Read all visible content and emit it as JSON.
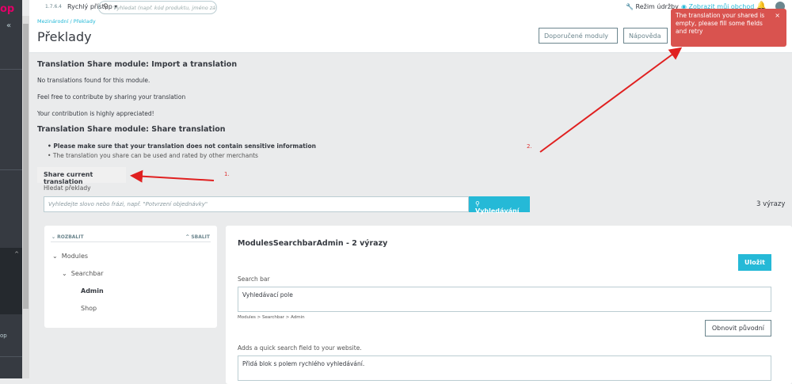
{
  "app": {
    "logo": "op",
    "version": "1.7.6.4",
    "quick_access": "Rychlý přístup",
    "search_placeholder": "Vyhledat (např. kód produktu, jméno zá",
    "maintenance": "Režim údržby",
    "view_shop": "Zobrazit můj obchod",
    "sidebar_item_partial": "op"
  },
  "header": {
    "breadcrumb": "Mezinárodní / Překlady",
    "title": "Překlady",
    "btn_modules": "Doporučené moduly",
    "btn_help": "Nápověda"
  },
  "toast": {
    "message": "The translation your shared is empty, please fill some fields and retry",
    "close": "×",
    "type": "error"
  },
  "import": {
    "title": "Translation Share module: Import a translation",
    "lines": [
      "No translations found for this module.",
      "Feel free to contribute by sharing your translation",
      "Your contribution is highly appreciated!"
    ]
  },
  "share": {
    "title": "Translation Share module: Share translation",
    "bullets": [
      "Please make sure that your translation does not contain sensitive information",
      "The translation you share can be used and rated by other merchants"
    ],
    "button": "Share current translation"
  },
  "search": {
    "label": "Hledat překlady",
    "placeholder": "Vyhledejte slovo nebo frázi, např. \"Potvrzení objednávky\"",
    "button": "Vyhledávání",
    "count": "3 výrazy"
  },
  "tree": {
    "expand": "ROZBALIT",
    "collapse": "SBALIT",
    "items": [
      "Modules",
      "Searchbar",
      "Admin",
      "Shop"
    ]
  },
  "editor": {
    "title": "ModulesSearchbarAdmin - 2 výrazy",
    "save": "Uložit",
    "entries": [
      {
        "label": "Search bar",
        "value": "Vyhledávací pole",
        "path": "Modules > Searchbar > Admin",
        "reset": "Obnovit původní"
      },
      {
        "label": "Adds a quick search field to your website.",
        "value": "Přidá blok s polem rychlého vyhledávání."
      }
    ]
  },
  "annotations": {
    "one": "1.",
    "two": "2."
  }
}
